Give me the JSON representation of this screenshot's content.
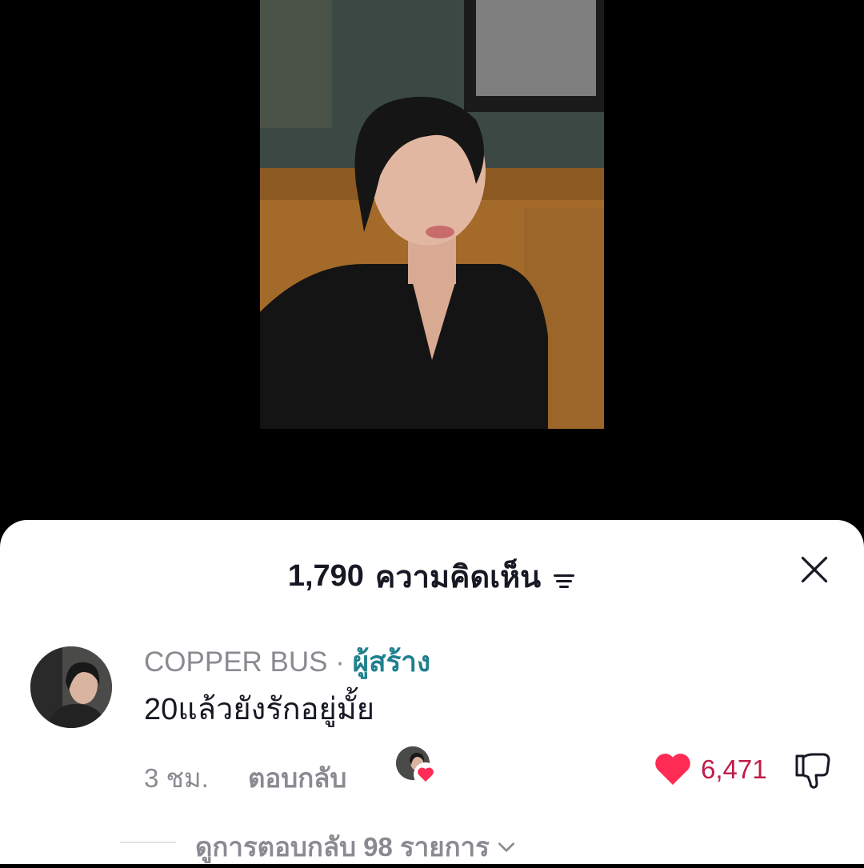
{
  "header": {
    "comment_count": "1,790",
    "comments_label": "ความคิดเห็น"
  },
  "comment": {
    "username": "COPPER BUS",
    "separator": "·",
    "creator_tag": "ผู้สร้าง",
    "text": "20แล้วยังรักอยู่มั้ย",
    "time": "3 ชม.",
    "reply_label": "ตอบกลับ",
    "like_count": "6,471",
    "liked": true
  },
  "replies": {
    "view_label": "ดูการตอบกลับ 98 รายการ"
  },
  "colors": {
    "like": "#fe2c55",
    "like_count": "#c01c48",
    "creator_tag": "#20808f",
    "secondary_text": "#8a8b91"
  },
  "icons": [
    "filter-icon",
    "close-icon",
    "heart-icon",
    "dislike-icon",
    "chevron-down-icon"
  ]
}
